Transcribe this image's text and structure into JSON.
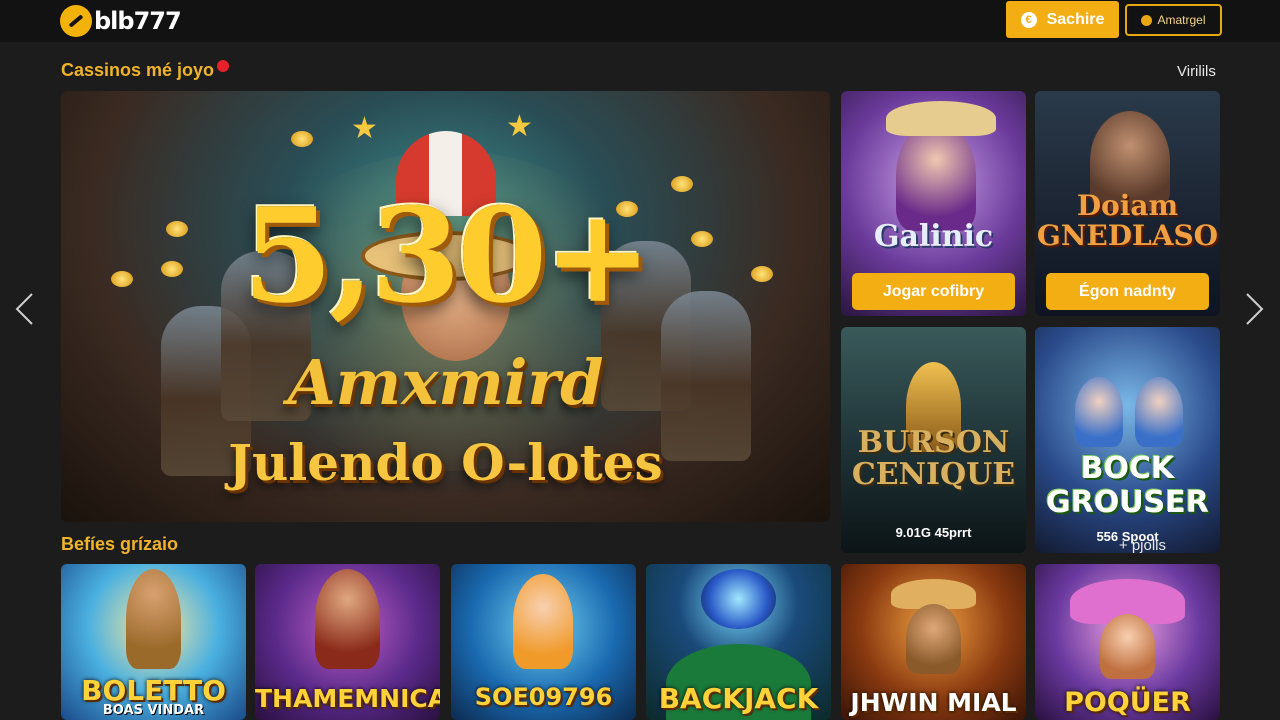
{
  "header": {
    "logo_text": "blb777",
    "primary_button": "Sachire",
    "secondary_button": "Amatrgel"
  },
  "section1": {
    "title": "Cassinos mé joyo",
    "link": "Virilils"
  },
  "hero": {
    "big_text": "5,30+",
    "line1": "Amxmird",
    "line2": "Julendo O-lotes"
  },
  "side_cards": [
    {
      "title": "Galinic",
      "button": "Jogar cofibry"
    },
    {
      "title": "Doiam GNEDLASO",
      "button": "Égon nadnty"
    },
    {
      "title": "BURSON CENIQUE",
      "caption": "9.01G 45prrt"
    },
    {
      "title": "BOCK GROUSER",
      "caption": "556 Spoot"
    }
  ],
  "section2": {
    "title": "Befíes grízaio",
    "link": "+ pjolls"
  },
  "bottom_cards": [
    {
      "title": "BOLETTO",
      "subtitle": "BOAS VINDAR"
    },
    {
      "title": "THAMEMNICA"
    },
    {
      "title": "SOE09796"
    },
    {
      "title": "BACKJACK"
    },
    {
      "title": "JHWIN MIAL"
    },
    {
      "title": "POQÜER"
    }
  ],
  "colors": {
    "accent": "#f3ae13",
    "background": "#1c1c1c",
    "topbar": "#121212",
    "section_title": "#f0b32a"
  }
}
